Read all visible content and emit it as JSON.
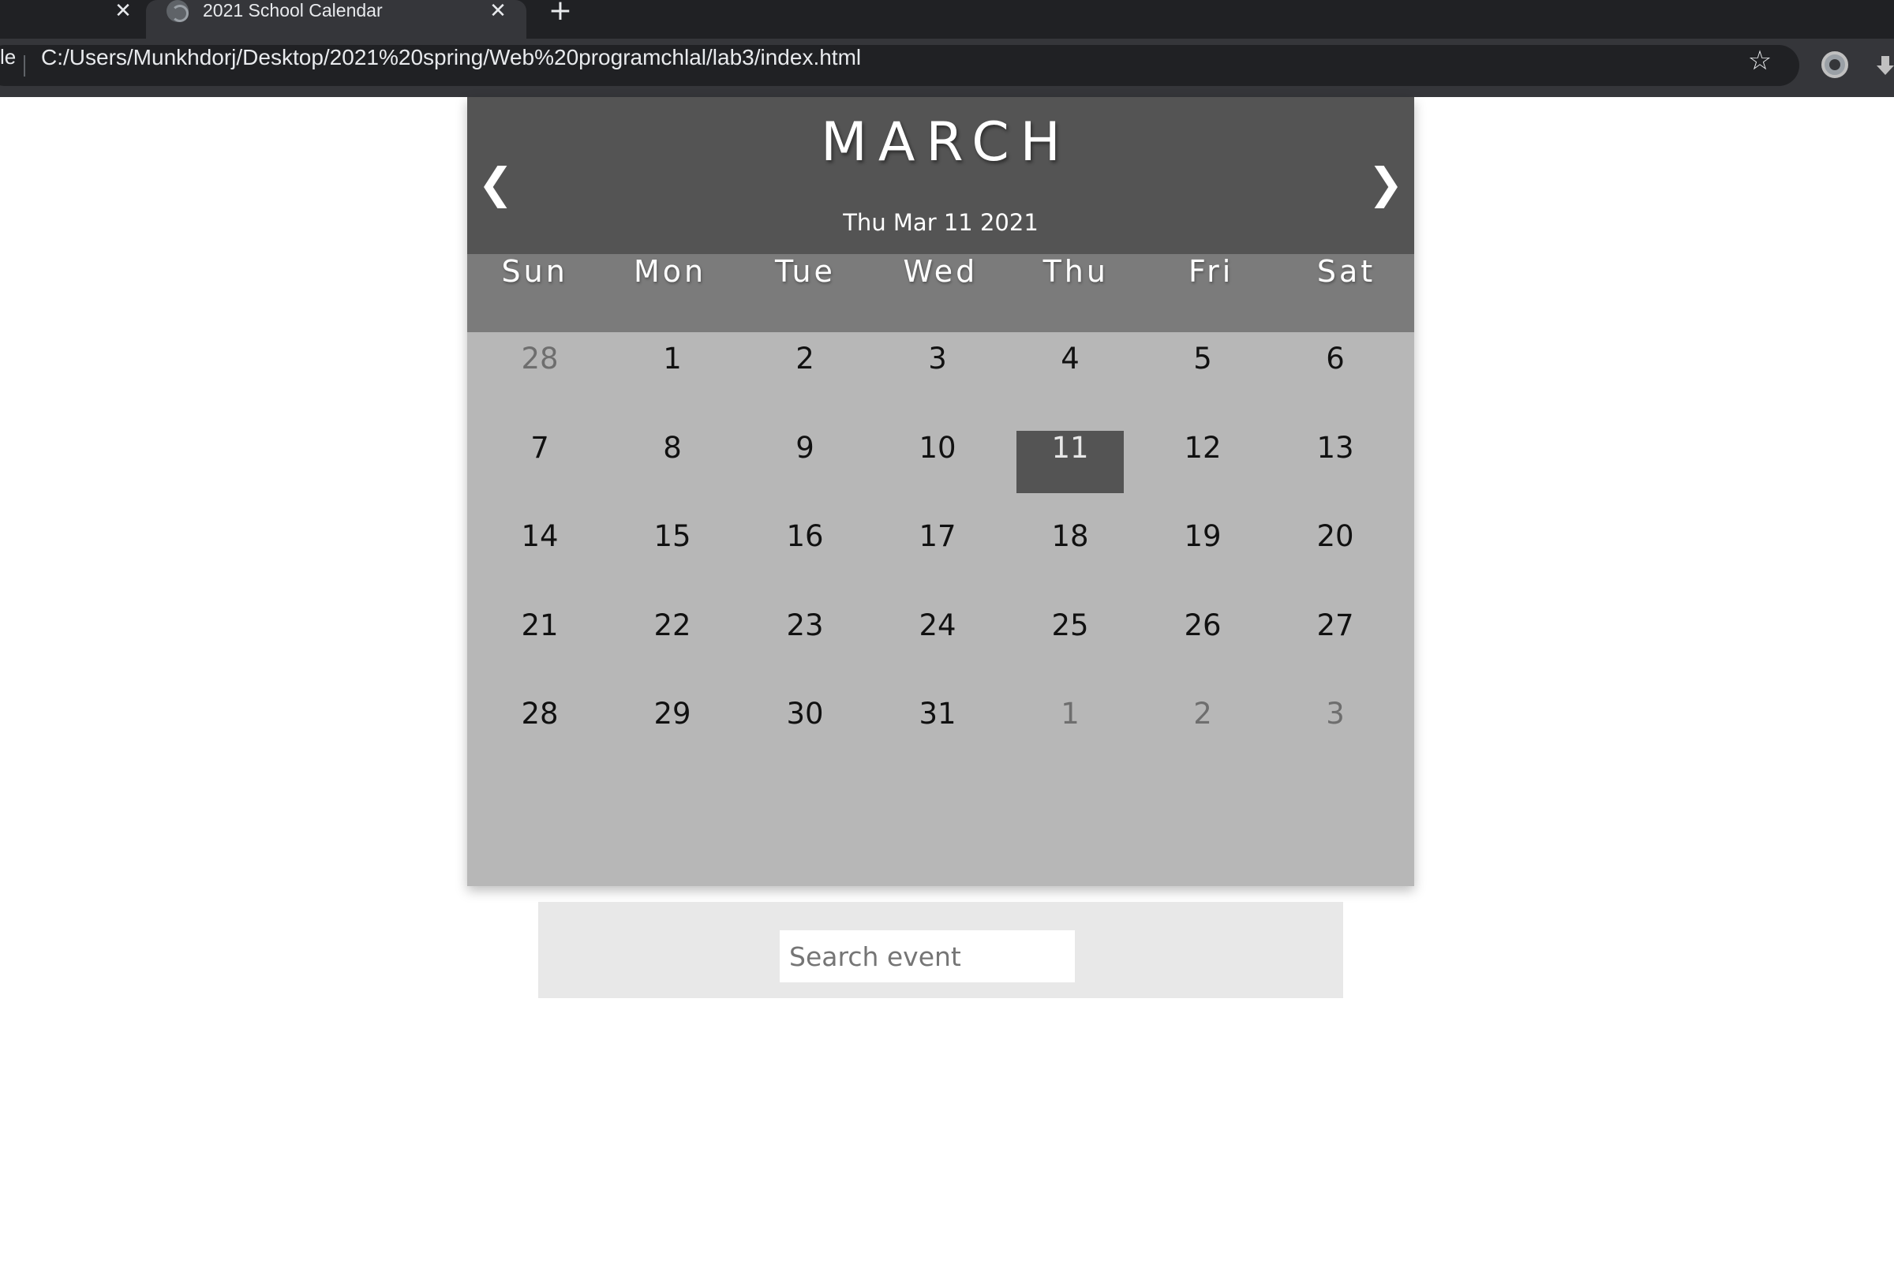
{
  "browser": {
    "tabs": [
      {
        "title": ""
      },
      {
        "title": "2021 School Calendar"
      }
    ],
    "close_glyph": "✕",
    "newtab_glyph": "+",
    "site_info_text": "le",
    "url": "C:/Users/Munkhdorj/Desktop/2021%20spring/Web%20programchlal/lab3/index.html",
    "star_glyph": "☆",
    "icons": [
      "globe-icon",
      "close-icon",
      "plus-icon",
      "star-icon",
      "extension-icon",
      "download-icon"
    ]
  },
  "calendar": {
    "month": "MARCH",
    "date_line": "Thu Mar 11 2021",
    "prev_glyph": "❮",
    "next_glyph": "❯",
    "weekdays": [
      "Sun",
      "Mon",
      "Tue",
      "Wed",
      "Thu",
      "Fri",
      "Sat"
    ],
    "days": [
      {
        "label": "28",
        "other": true
      },
      {
        "label": "1"
      },
      {
        "label": "2"
      },
      {
        "label": "3"
      },
      {
        "label": "4"
      },
      {
        "label": "5"
      },
      {
        "label": "6"
      },
      {
        "label": "7"
      },
      {
        "label": "8"
      },
      {
        "label": "9"
      },
      {
        "label": "10"
      },
      {
        "label": "11",
        "today": true
      },
      {
        "label": "12"
      },
      {
        "label": "13"
      },
      {
        "label": "14"
      },
      {
        "label": "15"
      },
      {
        "label": "16"
      },
      {
        "label": "17"
      },
      {
        "label": "18"
      },
      {
        "label": "19"
      },
      {
        "label": "20"
      },
      {
        "label": "21"
      },
      {
        "label": "22"
      },
      {
        "label": "23"
      },
      {
        "label": "24"
      },
      {
        "label": "25"
      },
      {
        "label": "26"
      },
      {
        "label": "27"
      },
      {
        "label": "28"
      },
      {
        "label": "29"
      },
      {
        "label": "30"
      },
      {
        "label": "31"
      },
      {
        "label": "1",
        "other": true
      },
      {
        "label": "2",
        "other": true
      },
      {
        "label": "3",
        "other": true
      }
    ],
    "colors": {
      "header": "#545454",
      "weekday_bar": "#7b7b7b",
      "body": "#b7b7b7",
      "today_highlight": "#545454"
    }
  },
  "search": {
    "placeholder": "Search event",
    "value": ""
  }
}
